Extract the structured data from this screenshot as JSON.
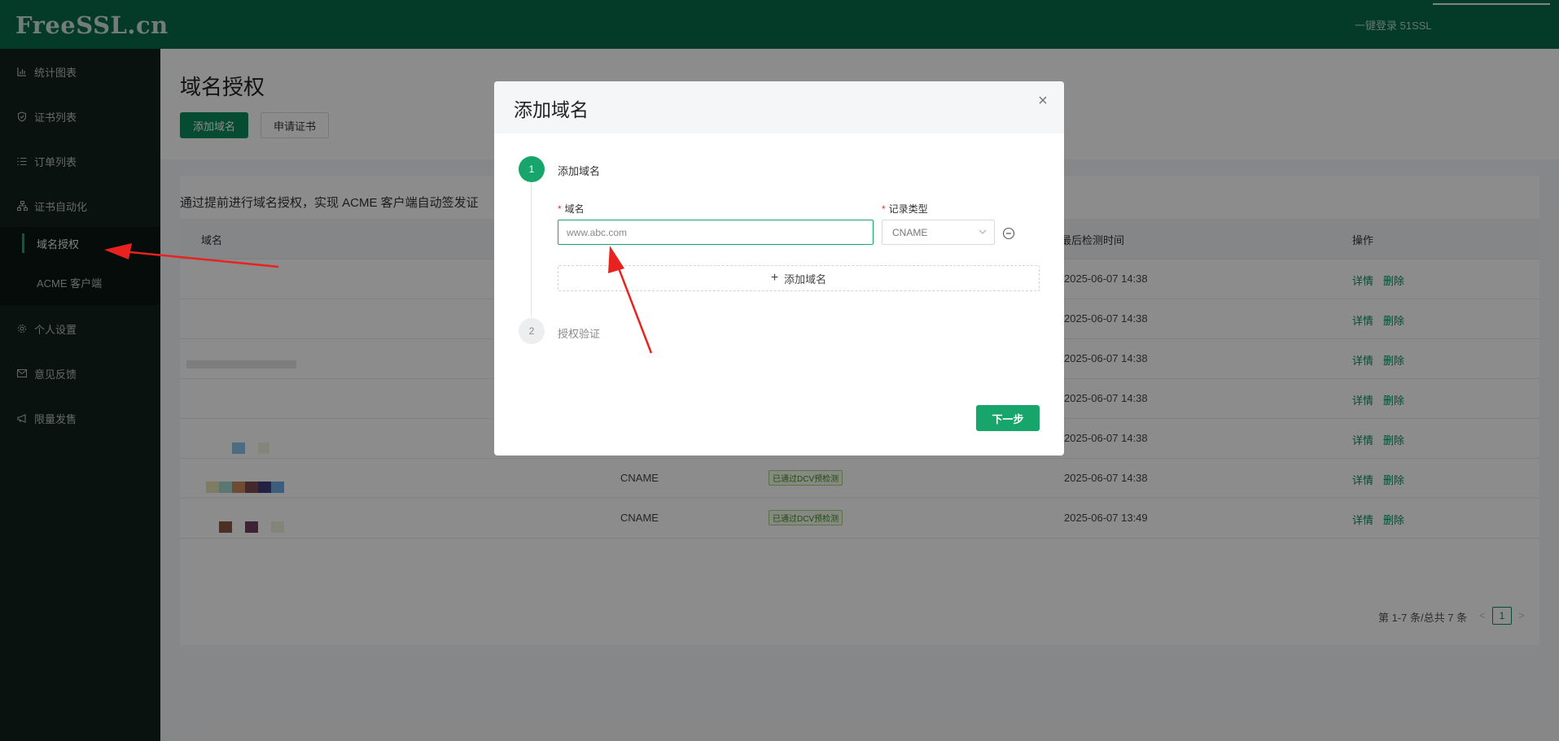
{
  "app": {
    "logo": "FreeSSL.cn",
    "top_login": "一键登录 51SSL"
  },
  "sidebar": {
    "items": [
      {
        "label": "统计图表",
        "icon": "bar-chart-icon"
      },
      {
        "label": "证书列表",
        "icon": "shield-icon"
      },
      {
        "label": "订单列表",
        "icon": "list-icon"
      },
      {
        "label": "证书自动化",
        "icon": "sitemap-icon"
      },
      {
        "label": "个人设置",
        "icon": "gear-icon"
      },
      {
        "label": "意见反馈",
        "icon": "mail-icon"
      },
      {
        "label": "限量发售",
        "icon": "megaphone-icon"
      }
    ],
    "sub_items": [
      {
        "label": "域名授权",
        "active": true
      },
      {
        "label": "ACME 客户端",
        "active": false
      }
    ]
  },
  "page": {
    "title": "域名授权",
    "add_button": "添加域名",
    "apply_button": "申请证书",
    "description": "通过提前进行域名授权，实现 ACME 客户端自动签发证"
  },
  "table": {
    "headers": {
      "domain": "域名",
      "last_check": "最后检测时间",
      "actions": "操作"
    },
    "rows": [
      {
        "record": "",
        "status": "",
        "time": "2025-06-07 14:38"
      },
      {
        "record": "",
        "status": "",
        "time": "2025-06-07 14:38"
      },
      {
        "record": "",
        "status": "",
        "time": "2025-06-07 14:38"
      },
      {
        "record": "",
        "status": "",
        "time": "2025-06-07 14:38"
      },
      {
        "record": "",
        "status": "",
        "time": "2025-06-07 14:38"
      },
      {
        "record": "CNAME",
        "status": "已通过DCV预检测",
        "time": "2025-06-07 14:38"
      },
      {
        "record": "CNAME",
        "status": "已通过DCV预检测",
        "time": "2025-06-07 13:49"
      }
    ],
    "action_detail": "详情",
    "action_delete": "删除"
  },
  "pagination": {
    "summary": "第 1-7 条/总共 7 条",
    "current_page": "1",
    "prev": "<",
    "next": ">"
  },
  "modal": {
    "title": "添加域名",
    "close": "×",
    "steps": [
      {
        "number": "1",
        "label": "添加域名"
      },
      {
        "number": "2",
        "label": "授权验证"
      }
    ],
    "domain_label": "域名",
    "domain_placeholder": "www.abc.com",
    "record_type_label": "记录类型",
    "record_type_value": "CNAME",
    "required_mark": "*",
    "add_domain_row": "添加域名",
    "next_button": "下一步"
  },
  "colors": {
    "brand": "#076a4a",
    "accent": "#17a56b",
    "annotation_arrow": "#e8231f"
  }
}
